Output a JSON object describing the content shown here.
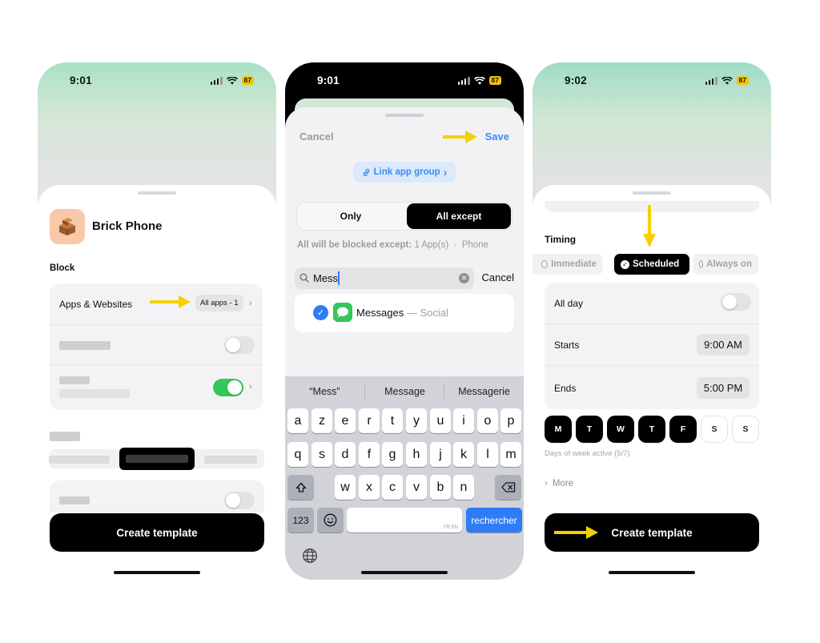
{
  "colors": {
    "accent_blue": "#3a8cf0",
    "arrow_yellow": "#f5d000",
    "toggle_on": "#34c759",
    "battery": "#f2c400"
  },
  "panel1": {
    "status": {
      "time": "9:01",
      "battery": "87"
    },
    "app_name": "Brick Phone",
    "block_label": "Block",
    "apps_row": {
      "label": "Apps & Websites",
      "value": "All apps - 1"
    },
    "create_button": "Create template"
  },
  "panel2": {
    "status": {
      "time": "9:01",
      "battery": "87"
    },
    "cancel": "Cancel",
    "save": "Save",
    "link_group": "Link app group",
    "segment": {
      "only": "Only",
      "all_except": "All except"
    },
    "except_info": {
      "prefix": "All will be blocked except:",
      "apps": "1 App(s)",
      "sep": "·",
      "category": "Phone"
    },
    "search": {
      "query": "Mess",
      "cancel": "Cancel"
    },
    "result": {
      "name": "Messages",
      "category": "— Social"
    },
    "suggestions": [
      "“Mess”",
      "Message",
      "Messagerie"
    ],
    "keyboard": {
      "row1": [
        "a",
        "z",
        "e",
        "r",
        "t",
        "y",
        "u",
        "i",
        "o",
        "p"
      ],
      "row2": [
        "q",
        "s",
        "d",
        "f",
        "g",
        "h",
        "j",
        "k",
        "l",
        "m"
      ],
      "row3": [
        "w",
        "x",
        "c",
        "v",
        "b",
        "n"
      ],
      "num": "123",
      "lang": "FR EN",
      "return": "rechercher"
    }
  },
  "panel3": {
    "status": {
      "time": "9:02",
      "battery": "87"
    },
    "timing_label": "Timing",
    "timing_options": [
      "Immediate",
      "Scheduled",
      "Always on"
    ],
    "timing_selected": "Scheduled",
    "all_day": "All day",
    "starts": {
      "label": "Starts",
      "value": "9:00 AM"
    },
    "ends": {
      "label": "Ends",
      "value": "5:00 PM"
    },
    "days": [
      "M",
      "T",
      "W",
      "T",
      "F",
      "S",
      "S"
    ],
    "days_active": [
      true,
      true,
      true,
      true,
      true,
      false,
      false
    ],
    "days_note": "Days of week active (5/7)",
    "more": "More",
    "create_button": "Create template"
  }
}
